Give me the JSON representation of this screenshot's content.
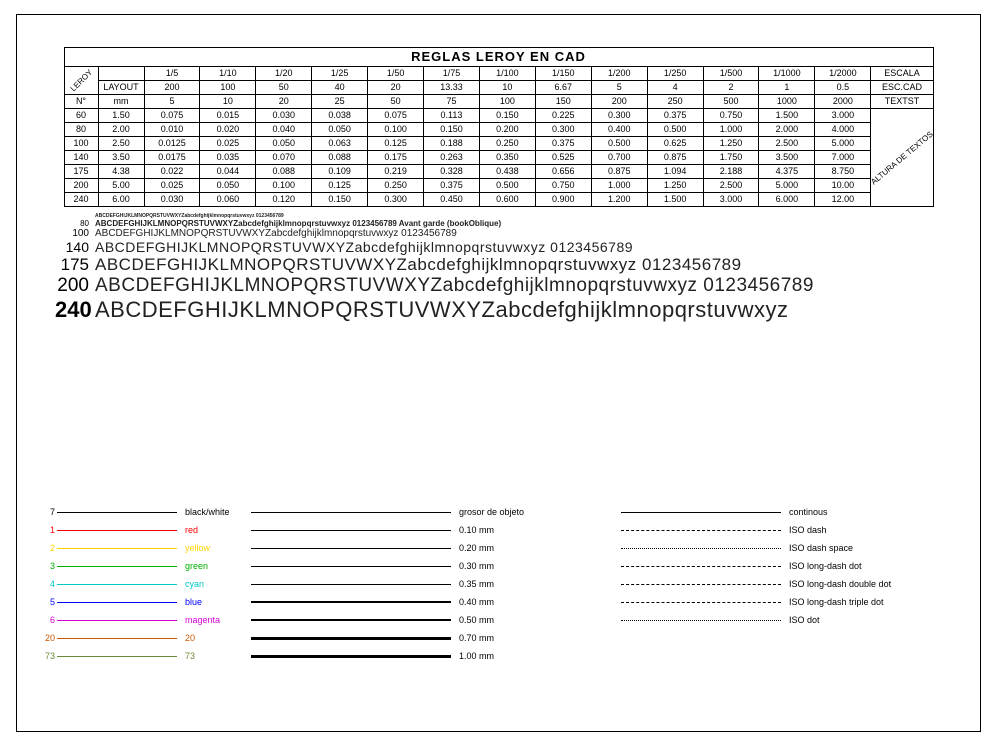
{
  "table": {
    "title": "REGLAS LEROY EN CAD",
    "label_leroy": "LEROY",
    "label_layout": "LAYOUT",
    "label_n": "N°",
    "label_mm": "mm",
    "label_escala": "ESCALA",
    "label_esccad": "ESC.CAD",
    "label_textst": "TEXTST",
    "label_altura": "ALTURA DE TEXTOS",
    "scales": [
      "1/5",
      "1/10",
      "1/20",
      "1/25",
      "1/50",
      "1/75",
      "1/100",
      "1/150",
      "1/200",
      "1/250",
      "1/500",
      "1/1000",
      "1/2000"
    ],
    "layouts": [
      "200",
      "100",
      "50",
      "40",
      "20",
      "13.33",
      "10",
      "6.67",
      "5",
      "4",
      "2",
      "1",
      "0.5"
    ],
    "mm_row": [
      "5",
      "10",
      "20",
      "25",
      "50",
      "75",
      "100",
      "150",
      "200",
      "250",
      "500",
      "1000",
      "2000"
    ],
    "rows": [
      {
        "n": "60",
        "mm": "1.50",
        "v": [
          "0.075",
          "0.015",
          "0.030",
          "0.038",
          "0.075",
          "0.113",
          "0.150",
          "0.225",
          "0.300",
          "0.375",
          "0.750",
          "1.500",
          "3.000"
        ]
      },
      {
        "n": "80",
        "mm": "2.00",
        "v": [
          "0.010",
          "0.020",
          "0.040",
          "0.050",
          "0.100",
          "0.150",
          "0.200",
          "0.300",
          "0.400",
          "0.500",
          "1.000",
          "2.000",
          "4.000"
        ]
      },
      {
        "n": "100",
        "mm": "2.50",
        "v": [
          "0.0125",
          "0.025",
          "0.050",
          "0.063",
          "0.125",
          "0.188",
          "0.250",
          "0.375",
          "0.500",
          "0.625",
          "1.250",
          "2.500",
          "5.000"
        ]
      },
      {
        "n": "140",
        "mm": "3.50",
        "v": [
          "0.0175",
          "0.035",
          "0.070",
          "0.088",
          "0.175",
          "0.263",
          "0.350",
          "0.525",
          "0.700",
          "0.875",
          "1.750",
          "3.500",
          "7.000"
        ]
      },
      {
        "n": "175",
        "mm": "4.38",
        "v": [
          "0.022",
          "0.044",
          "0.088",
          "0.109",
          "0.219",
          "0.328",
          "0.438",
          "0.656",
          "0.875",
          "1.094",
          "2.188",
          "4.375",
          "8.750"
        ]
      },
      {
        "n": "200",
        "mm": "5.00",
        "v": [
          "0.025",
          "0.050",
          "0.100",
          "0.125",
          "0.250",
          "0.375",
          "0.500",
          "0.750",
          "1.000",
          "1.250",
          "2.500",
          "5.000",
          "10.00"
        ]
      },
      {
        "n": "240",
        "mm": "6.00",
        "v": [
          "0.030",
          "0.060",
          "0.120",
          "0.150",
          "0.300",
          "0.450",
          "0.600",
          "0.900",
          "1.200",
          "1.500",
          "3.000",
          "6.000",
          "12.00"
        ]
      }
    ]
  },
  "samples": [
    {
      "label": "",
      "size": 5,
      "weight": "bold",
      "text": "ABCDEFGHIJKLMNOPQRSTUVWXYZabcdefghijklmnopqrstuvwxyz 0123456789"
    },
    {
      "label": "80",
      "size": 8,
      "weight": "bold",
      "text": "ABCDEFGHIJKLMNOPQRSTUVWXYZabcdefghijklmnopqrstuvwxyz 0123456789  Avant garde (bookOblique)"
    },
    {
      "label": "100",
      "size": 10,
      "weight": "normal",
      "text": "ABCDEFGHIJKLMNOPQRSTUVWXYZabcdefghijklmnopqrstuvwxyz 0123456789"
    },
    {
      "label": "140",
      "size": 14,
      "weight": "normal",
      "text": "ABCDEFGHIJKLMNOPQRSTUVWXYZabcdefghijklmnopqrstuvwxyz 0123456789"
    },
    {
      "label": "175",
      "size": 17,
      "weight": "normal",
      "text": "ABCDEFGHIJKLMNOPQRSTUVWXYZabcdefghijklmnopqrstuvwxyz  0123456789"
    },
    {
      "label": "200",
      "size": 19,
      "weight": "normal",
      "text": "ABCDEFGHIJKLMNOPQRSTUVWXYZabcdefghijklmnopqrstuvwxyz  0123456789"
    },
    {
      "label": "240",
      "size": 22,
      "weight": "normal",
      "text": "ABCDEFGHIJKLMNOPQRSTUVWXYZabcdefghijklmnopqrstuvwxyz"
    }
  ],
  "colors": [
    {
      "num": "7",
      "name": "black/white",
      "color": "#000000"
    },
    {
      "num": "1",
      "name": "red",
      "color": "#ff0000"
    },
    {
      "num": "2",
      "name": "yellow",
      "color": "#ffd400"
    },
    {
      "num": "3",
      "name": "green",
      "color": "#00b000"
    },
    {
      "num": "4",
      "name": "cyan",
      "color": "#00c8c8"
    },
    {
      "num": "5",
      "name": "blue",
      "color": "#0000ff"
    },
    {
      "num": "6",
      "name": "magenta",
      "color": "#d400d4"
    },
    {
      "num": "20",
      "name": "20",
      "color": "#cc5500"
    },
    {
      "num": "73",
      "name": "73",
      "color": "#6a8a3a"
    }
  ],
  "weights_header": "grosor de objeto",
  "weights": [
    {
      "w": "0.10 mm",
      "px": 1
    },
    {
      "w": "0.20 mm",
      "px": 1
    },
    {
      "w": "0.30 mm",
      "px": 1
    },
    {
      "w": "0.35 mm",
      "px": 1
    },
    {
      "w": "0.40 mm",
      "px": 2
    },
    {
      "w": "0.50 mm",
      "px": 2
    },
    {
      "w": "0.70 mm",
      "px": 3
    },
    {
      "w": "1.00 mm",
      "px": 3
    }
  ],
  "linetypes_header": "continous",
  "linetypes": [
    {
      "name": "continous",
      "style": "solid"
    },
    {
      "name": "ISO dash",
      "style": "dashed"
    },
    {
      "name": "ISO dash space",
      "style": "dotted"
    },
    {
      "name": "ISO long-dash dot",
      "style": "dashed"
    },
    {
      "name": "ISO long-dash double dot",
      "style": "dashed"
    },
    {
      "name": "ISO long-dash triple dot",
      "style": "dashed"
    },
    {
      "name": "ISO dot",
      "style": "dotted"
    }
  ]
}
